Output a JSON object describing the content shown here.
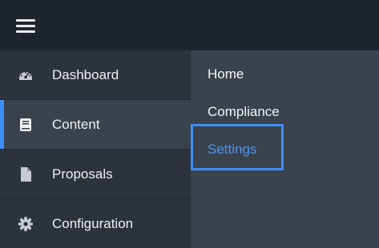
{
  "sidebar": {
    "items": [
      {
        "label": "Dashboard",
        "icon": "dashboard-gauge-icon",
        "active": false
      },
      {
        "label": "Content",
        "icon": "book-icon",
        "active": true
      },
      {
        "label": "Proposals",
        "icon": "document-icon",
        "active": false
      },
      {
        "label": "Configuration",
        "icon": "gear-icon",
        "active": false
      }
    ]
  },
  "submenu": {
    "items": [
      {
        "label": "Home"
      },
      {
        "label": "Compliance"
      },
      {
        "label": "Settings"
      }
    ]
  },
  "colors": {
    "topbar": "#1f252d",
    "sidebar": "#2c333c",
    "active_item": "#3a424d",
    "submenu": "#3a424d",
    "accent": "#3f8ef5"
  }
}
